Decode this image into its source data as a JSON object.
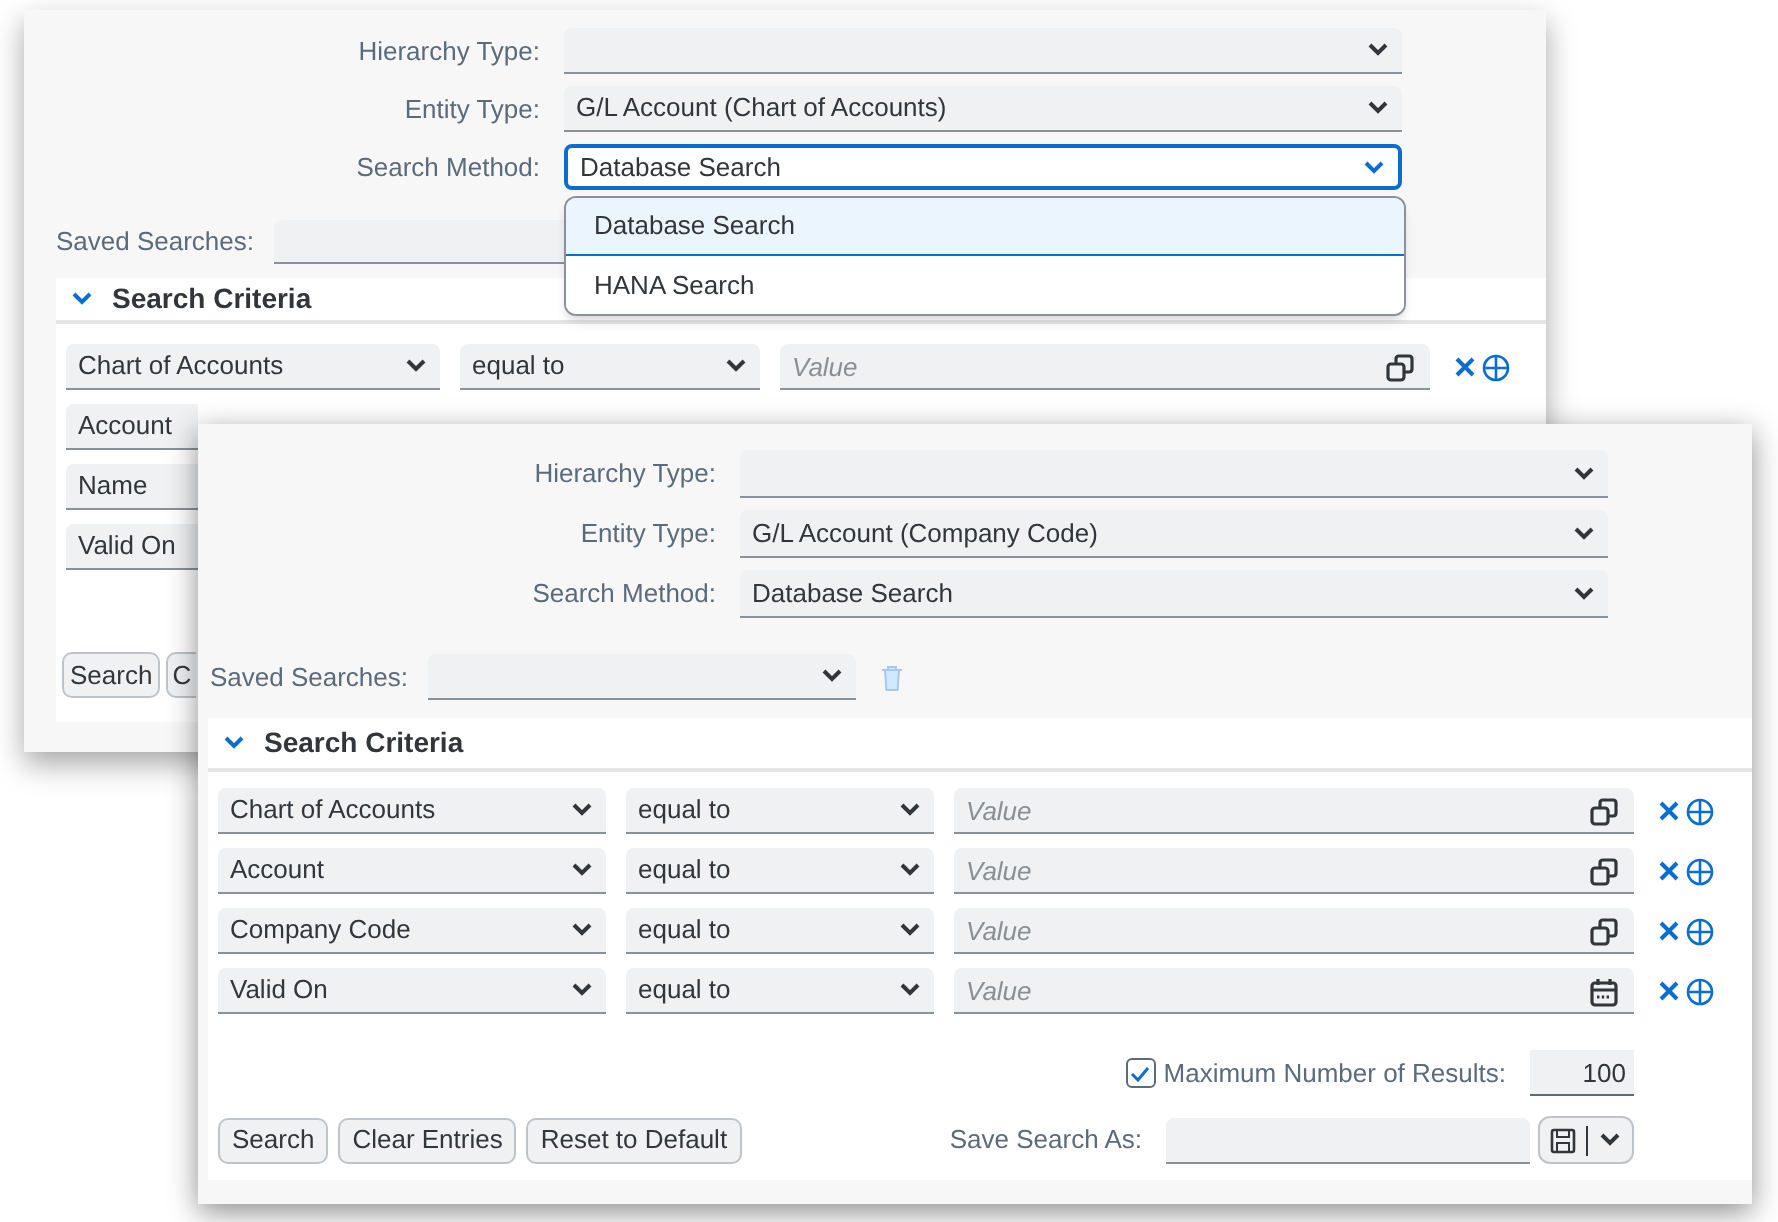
{
  "back_window": {
    "form": [
      {
        "label": "Hierarchy Type:"
      },
      {
        "label": "Entity Type:",
        "value": "G/L Account (Chart of Accounts)"
      },
      {
        "label": "Search Method:",
        "value": "Database Search",
        "focused": true,
        "options": [
          {
            "label": "Database Search",
            "selected": true
          },
          {
            "label": "HANA Search",
            "selected": false
          }
        ]
      }
    ],
    "saved_searches": {
      "label": "Saved Searches:"
    },
    "search_criteria": {
      "title": "Search Criteria",
      "expanded": true,
      "rows": [
        {
          "field": "Chart of Accounts",
          "operator": "equal to",
          "placeholder": "Value",
          "kind": "value-help"
        },
        {
          "field": "Account"
        },
        {
          "field": "Name"
        },
        {
          "field": "Valid On"
        }
      ]
    },
    "buttons": [
      "Search",
      "C"
    ]
  },
  "front_window": {
    "form": [
      {
        "label": "Hierarchy Type:"
      },
      {
        "label": "Entity Type:",
        "value": "G/L Account (Company Code)"
      },
      {
        "label": "Search Method:",
        "value": "Database Search",
        "focused": false
      }
    ],
    "saved_searches": {
      "label": "Saved Searches:"
    },
    "search_criteria": {
      "title": "Search Criteria",
      "expanded": true,
      "rows": [
        {
          "field": "Chart of Accounts",
          "operator": "equal to",
          "placeholder": "Value",
          "kind": "value-help"
        },
        {
          "field": "Account",
          "operator": "equal to",
          "placeholder": "Value",
          "kind": "value-help"
        },
        {
          "field": "Company Code",
          "operator": "equal to",
          "placeholder": "Value",
          "kind": "value-help"
        },
        {
          "field": "Valid On",
          "operator": "equal to",
          "placeholder": "Value",
          "kind": "date"
        }
      ]
    },
    "max_results": {
      "label": "Maximum Number of Results:",
      "checked": true,
      "value": "100"
    },
    "buttons": [
      "Search",
      "Clear Entries",
      "Reset to Default"
    ],
    "save_search_as": {
      "label": "Save Search As:"
    }
  }
}
